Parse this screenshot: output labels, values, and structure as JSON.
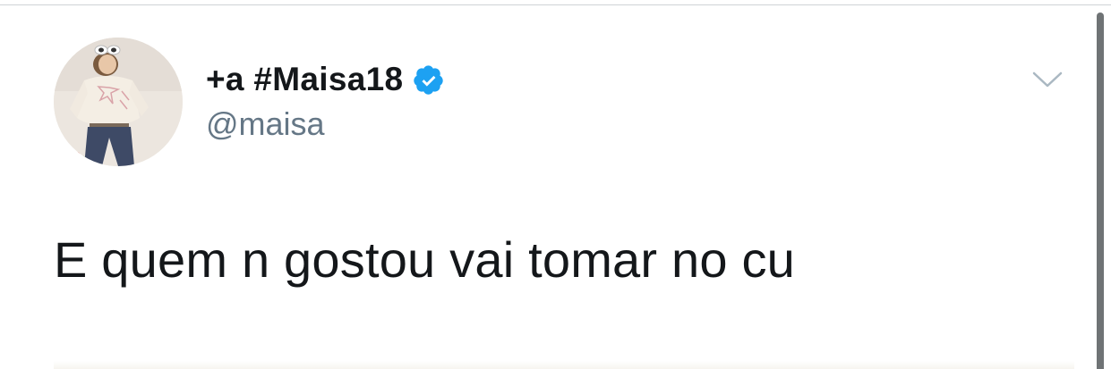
{
  "tweet": {
    "display_name": "+a #Maisa18",
    "handle": "@maisa",
    "text": "E quem n gostou vai tomar no cu",
    "verified": true
  },
  "icons": {
    "verified": "verified-badge-icon",
    "caret": "chevron-down-icon",
    "avatar": "profile-photo"
  },
  "colors": {
    "name_text": "#14171a",
    "handle_text": "#657786",
    "verified_blue": "#1da1f2",
    "caret": "#aab8c2",
    "background": "#ffffff",
    "scrollbar": "#6f7375"
  }
}
